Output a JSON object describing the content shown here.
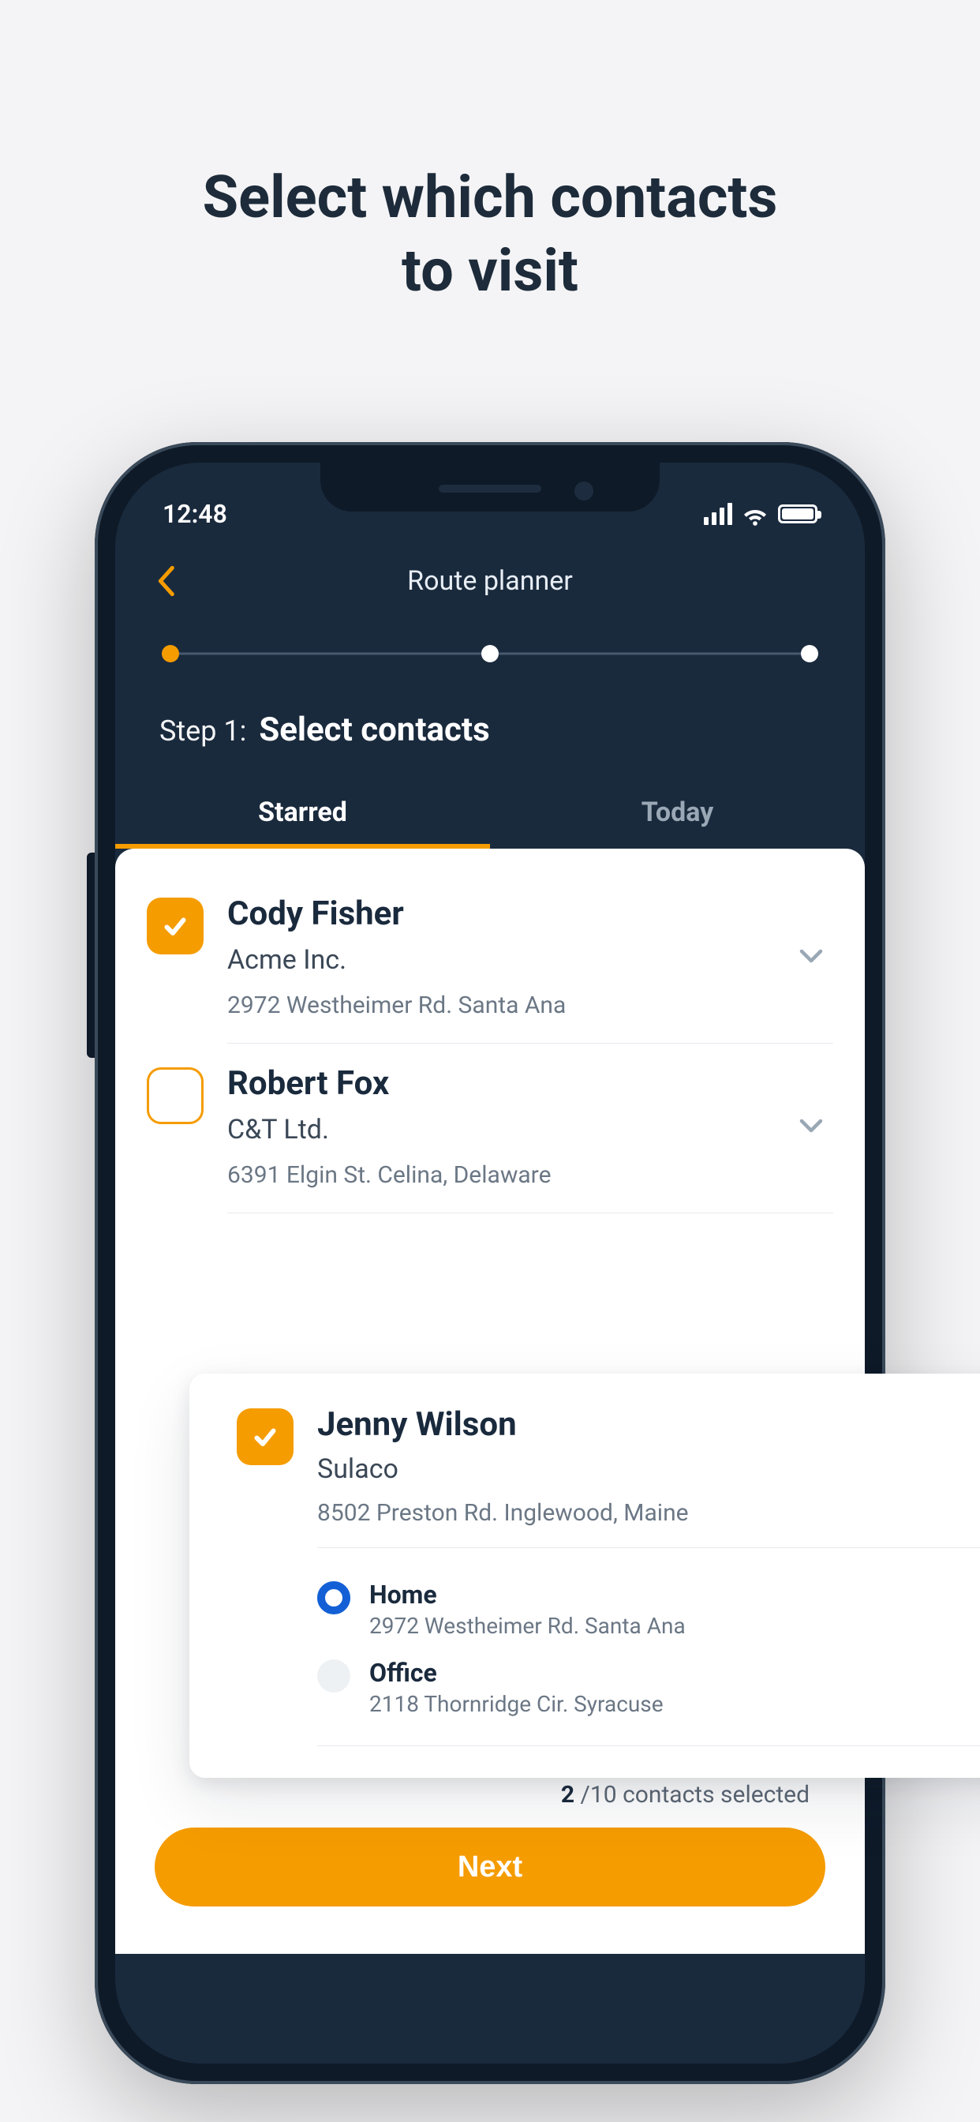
{
  "promo": {
    "title_line1": "Select which contacts",
    "title_line2": "to visit"
  },
  "status": {
    "time": "12:48"
  },
  "nav": {
    "title": "Route planner"
  },
  "step": {
    "label": "Step 1:",
    "title": "Select contacts",
    "current": 1,
    "total": 3
  },
  "tabs": [
    {
      "label": "Starred",
      "active": true
    },
    {
      "label": "Today",
      "active": false
    }
  ],
  "contacts": [
    {
      "name": "Cody Fisher",
      "company": "Acme Inc.",
      "address": "2972 Westheimer Rd. Santa Ana",
      "checked": true,
      "expanded": false
    },
    {
      "name": "Robert Fox",
      "company": "C&T Ltd.",
      "address": "6391 Elgin St. Celina, Delaware",
      "checked": false,
      "expanded": false
    },
    {
      "name": "Jenny Wilson",
      "company": "Sulaco",
      "address": "8502 Preston Rd. Inglewood, Maine",
      "checked": true,
      "expanded": true,
      "addresses": [
        {
          "label": "Home",
          "detail": "2972 Westheimer Rd. Santa Ana",
          "selected": true
        },
        {
          "label": "Office",
          "detail": "2118 Thornridge Cir. Syracuse",
          "selected": false
        }
      ]
    }
  ],
  "footer": {
    "selected_count": "2",
    "selected_total_text": " /10 contacts selected",
    "next_label": "Next"
  },
  "colors": {
    "accent": "#f59c00",
    "dark": "#1a2a3d",
    "radio_selected": "#1360d6"
  }
}
